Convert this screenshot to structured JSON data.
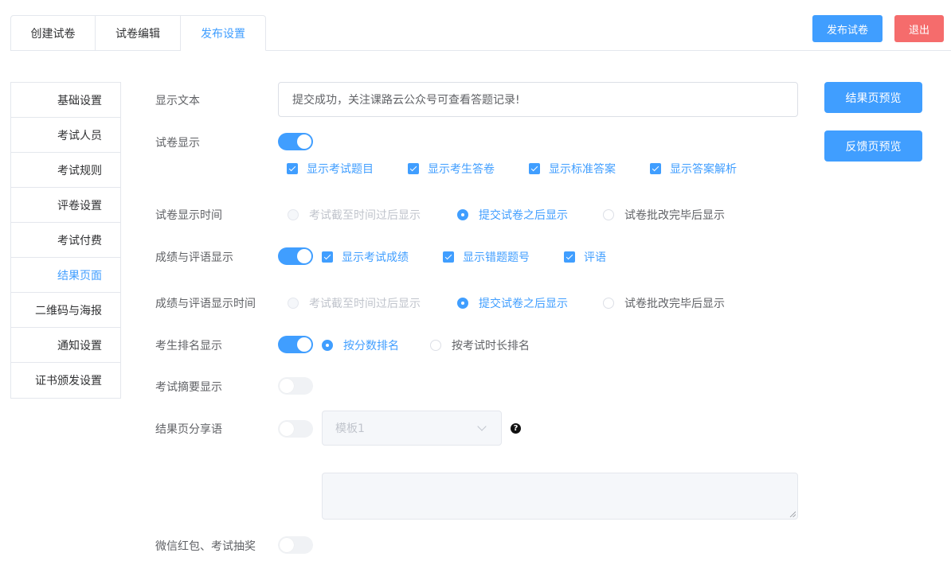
{
  "top_tabs": [
    "创建试卷",
    "试卷编辑",
    "发布设置"
  ],
  "header_buttons": {
    "publish": "发布试卷",
    "exit": "退出"
  },
  "side_nav": [
    "基础设置",
    "考试人员",
    "考试规则",
    "评卷设置",
    "考试付费",
    "结果页面",
    "二维码与海报",
    "通知设置",
    "证书颁发设置"
  ],
  "form": {
    "display_text": {
      "label": "显示文本",
      "value": "提交成功，关注课路云公众号可查看答题记录!"
    },
    "paper_display": {
      "label": "试卷显示",
      "enabled": true,
      "options": [
        "显示考试题目",
        "显示考生答卷",
        "显示标准答案",
        "显示答案解析"
      ]
    },
    "paper_display_time": {
      "label": "试卷显示时间",
      "options": [
        "考试截至时间过后显示",
        "提交试卷之后显示",
        "试卷批改完毕后显示"
      ],
      "selected": "提交试卷之后显示"
    },
    "score_comment_display": {
      "label": "成绩与评语显示",
      "enabled": true,
      "options": [
        "显示考试成绩",
        "显示错题题号",
        "评语"
      ]
    },
    "score_comment_time": {
      "label": "成绩与评语显示时间",
      "options": [
        "考试截至时间过后显示",
        "提交试卷之后显示",
        "试卷批改完毕后显示"
      ],
      "selected": "提交试卷之后显示"
    },
    "ranking_display": {
      "label": "考生排名显示",
      "enabled": true,
      "options": [
        "按分数排名",
        "按考试时长排名"
      ],
      "selected": "按分数排名"
    },
    "summary_display": {
      "label": "考试摘要显示",
      "enabled": false
    },
    "share_text": {
      "label": "结果页分享语",
      "enabled": false,
      "template": "模板1",
      "help": "?"
    },
    "wechat_lottery": {
      "label": "微信红包、考试抽奖",
      "enabled": false
    }
  },
  "preview_buttons": {
    "result": "结果页预览",
    "feedback": "反馈页预览"
  },
  "colors": {
    "primary": "#409eff",
    "danger": "#f56c6c",
    "border": "#e4e7ed"
  }
}
